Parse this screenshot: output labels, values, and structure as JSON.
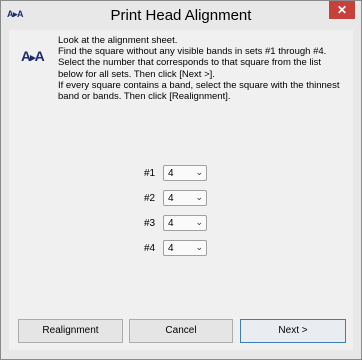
{
  "window": {
    "title": "Print Head Alignment",
    "app_icon": "A▶A",
    "close": "✕"
  },
  "instructions": {
    "line1": "Look at the alignment sheet.",
    "line2": "Find the square without any visible bands in sets #1 through #4. Select the number that corresponds to that square from the list below for all sets. Then click [Next >].",
    "line3": "If every square contains a band, select the square with the thinnest band or bands. Then click [Realignment]."
  },
  "sets": [
    {
      "label": "#1",
      "value": "4"
    },
    {
      "label": "#2",
      "value": "4"
    },
    {
      "label": "#3",
      "value": "4"
    },
    {
      "label": "#4",
      "value": "4"
    }
  ],
  "buttons": {
    "realignment": "Realignment",
    "cancel": "Cancel",
    "next": "Next >"
  }
}
